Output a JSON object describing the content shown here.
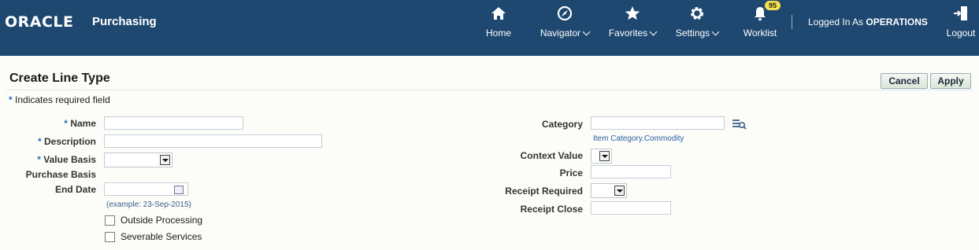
{
  "header": {
    "logo": "ORACLE",
    "app_name": "Purchasing",
    "nav": {
      "home": "Home",
      "navigator": "Navigator",
      "favorites": "Favorites",
      "settings": "Settings",
      "worklist": "Worklist",
      "worklist_badge": "95",
      "logout": "Logout"
    },
    "logged_in_prefix": "Logged In As",
    "logged_in_user": "OPERATIONS"
  },
  "page": {
    "title": "Create Line Type",
    "required_star": "*",
    "required_note": "Indicates required field",
    "cancel_label": "Cancel",
    "apply_label": "Apply"
  },
  "form": {
    "name_label": "Name",
    "description_label": "Description",
    "value_basis_label": "Value Basis",
    "purchase_basis_label": "Purchase Basis",
    "end_date_label": "End Date",
    "end_date_hint": "(example: 23-Sep-2015)",
    "outside_processing_label": "Outside Processing",
    "severable_services_label": "Severable Services",
    "category_label": "Category",
    "category_link": "Item Category.Commodity",
    "context_value_label": "Context Value",
    "price_label": "Price",
    "receipt_required_label": "Receipt Required",
    "receipt_close_label": "Receipt Close"
  },
  "colors": {
    "header_bg": "#1e4870",
    "page_bg": "#fcfcf8",
    "required_star": "#2e6ec0",
    "badge": "#f6e24a"
  }
}
